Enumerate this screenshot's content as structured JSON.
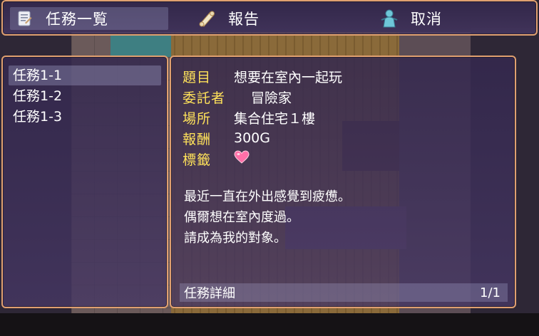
{
  "commands": [
    {
      "label": "任務一覧",
      "icon": "quest-list-icon",
      "selected": true
    },
    {
      "label": "報告",
      "icon": "scroll-icon",
      "selected": false
    },
    {
      "label": "取消",
      "icon": "person-icon",
      "selected": false
    }
  ],
  "quest_list": {
    "items": [
      "任務1-1",
      "任務1-2",
      "任務1-3"
    ],
    "selected_index": 0
  },
  "details": {
    "title_label": "題目",
    "title_value": "想要在室內一起玩",
    "client_label": "委託者",
    "client_value": "冒險家",
    "place_label": "場所",
    "place_value": "集合住宅１樓",
    "reward_label": "報酬",
    "reward_value": "300G",
    "tag_label": "標籤",
    "tag_icon": "heart-icon",
    "description": [
      "最近一直在外出感覺到疲憊。",
      "偶爾想在室內度過。",
      "請成為我的對象。"
    ],
    "footer_label": "任務詳細",
    "footer_page": "1/1"
  },
  "colors": {
    "border": "#e0a070",
    "label": "#ffe25a",
    "heart": "#ff6fa8"
  }
}
